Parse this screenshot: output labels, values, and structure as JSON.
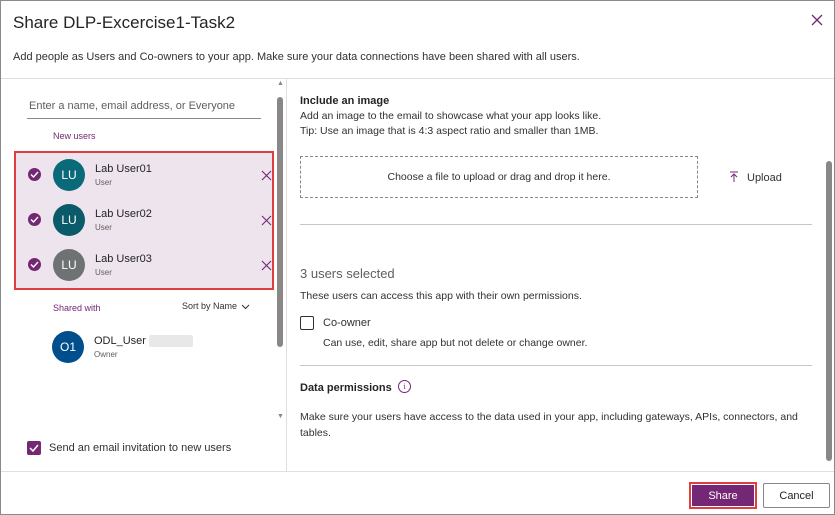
{
  "dialog": {
    "title": "Share DLP-Excercise1-Task2",
    "subtitle": "Add people as Users and Co-owners to your app. Make sure your data connections have been shared with all users.",
    "close_icon": "close-icon"
  },
  "left": {
    "search_placeholder": "Enter a name, email address, or Everyone",
    "new_users_label": "New users",
    "new_users": [
      {
        "initials": "LU",
        "name": "Lab User01",
        "role": "User",
        "color": "#0b6a7a"
      },
      {
        "initials": "LU",
        "name": "Lab User02",
        "role": "User",
        "color": "#0b5a6a"
      },
      {
        "initials": "LU",
        "name": "Lab User03",
        "role": "User",
        "color": "#6e7272"
      }
    ],
    "shared_with_label": "Shared with",
    "sort_label": "Sort by Name",
    "owner": {
      "initials": "O1",
      "name": "ODL_User",
      "role": "Owner",
      "color": "#004e8c"
    },
    "email_invite_label": "Send an email invitation to new users",
    "email_invite_checked": true
  },
  "right": {
    "include_image_title": "Include an image",
    "include_image_desc": "Add an image to the email to showcase what your app looks like.",
    "include_image_tip": "Tip: Use an image that is 4:3 aspect ratio and smaller than 1MB.",
    "dropzone_text": "Choose a file to upload or drag and drop it here.",
    "upload_label": "Upload",
    "selected_count": "3 users selected",
    "selected_desc": "These users can access this app with their own permissions.",
    "coowner_label": "Co-owner",
    "coowner_checked": false,
    "coowner_desc": "Can use, edit, share app but not delete or change owner.",
    "data_permissions_title": "Data permissions",
    "data_permissions_desc": "Make sure your users have access to the data used in your app, including gateways, APIs, connectors, and tables."
  },
  "footer": {
    "share_label": "Share",
    "cancel_label": "Cancel"
  },
  "colors": {
    "accent": "#742774",
    "highlight_border": "#e03e3e",
    "selected_bg": "#ede4ed"
  }
}
